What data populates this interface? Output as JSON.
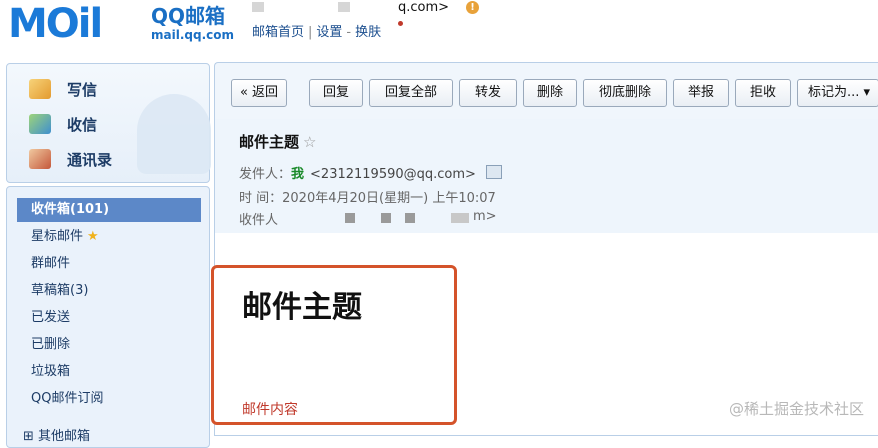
{
  "header": {
    "logo_text": "MOil",
    "brand": "QQ邮箱",
    "domain": "mail.qq.com",
    "user_email": "q.com>",
    "nav": [
      "邮箱首页",
      "设置",
      "换肤"
    ],
    "nav_separators": [
      "|",
      "-"
    ]
  },
  "sidebar": {
    "actions": [
      {
        "label": "写信",
        "icon": "compose-icon"
      },
      {
        "label": "收信",
        "icon": "receive-icon"
      },
      {
        "label": "通讯录",
        "icon": "contacts-icon"
      }
    ],
    "folders": [
      {
        "label": "收件箱(101)",
        "active": true
      },
      {
        "label": "星标邮件",
        "star": "★"
      },
      {
        "label": "群邮件"
      },
      {
        "label": "草稿箱(3)"
      },
      {
        "label": "已发送"
      },
      {
        "label": "已删除"
      },
      {
        "label": "垃圾箱"
      },
      {
        "label": "QQ邮件订阅"
      }
    ],
    "more": "⊞ 其他邮箱"
  },
  "toolbar": {
    "buttons": [
      "« 返回",
      "回复",
      "回复全部",
      "转发",
      "删除",
      "彻底删除",
      "举报",
      "拒收",
      "标记为... ▾"
    ]
  },
  "mail": {
    "subject": "邮件主题",
    "star": "☆",
    "from_label": "发件人：",
    "from_name": "我",
    "from_addr": "<2312119590@qq.com>",
    "time_label": "时    间：",
    "time_value": "2020年4月20日(星期一) 上午10:07",
    "to_label": "收件人",
    "to_value": "m>"
  },
  "preview": {
    "title": "邮件主题",
    "content": "邮件内容"
  },
  "watermark": "@稀土掘金技术社区",
  "colors": {
    "accent": "#5c88c8",
    "highlight_border": "#d4532a",
    "content_red": "#c0392b",
    "sender_green": "#1a8a2a"
  }
}
